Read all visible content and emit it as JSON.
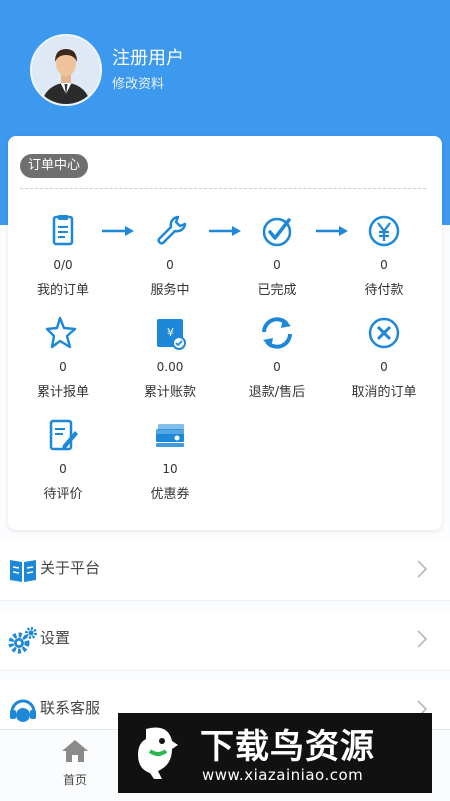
{
  "user": {
    "name": "注册用户",
    "edit_label": "修改资料"
  },
  "order_center": {
    "title": "订单中心",
    "items": [
      {
        "value": "0/0",
        "label": "我的订单",
        "icon": "clipboard-icon"
      },
      {
        "value": "0",
        "label": "服务中",
        "icon": "wrench-icon"
      },
      {
        "value": "0",
        "label": "已完成",
        "icon": "check-circle-icon"
      },
      {
        "value": "0",
        "label": "待付款",
        "icon": "yen-icon"
      },
      {
        "value": "0",
        "label": "累计报单",
        "icon": "star-icon"
      },
      {
        "value": "0.00",
        "label": "累计账款",
        "icon": "account-icon"
      },
      {
        "value": "0",
        "label": "退款/售后",
        "icon": "refresh-icon"
      },
      {
        "value": "0",
        "label": "取消的订单",
        "icon": "cancel-icon"
      },
      {
        "value": "0",
        "label": "待评价",
        "icon": "edit-icon"
      },
      {
        "value": "10",
        "label": "优惠券",
        "icon": "coupon-icon"
      }
    ]
  },
  "menu": [
    {
      "label": "关于平台",
      "icon": "book-icon"
    },
    {
      "label": "设置",
      "icon": "gear-icon"
    },
    {
      "label": "联系客服",
      "icon": "headset-icon"
    }
  ],
  "bottom_nav": {
    "home_label": "首页"
  },
  "watermark": {
    "title": "下载鸟资源",
    "url": "www.xiazainiao.com"
  },
  "colors": {
    "accent": "#3d99ee",
    "icon": "#1e88d8",
    "text": "#333333"
  }
}
